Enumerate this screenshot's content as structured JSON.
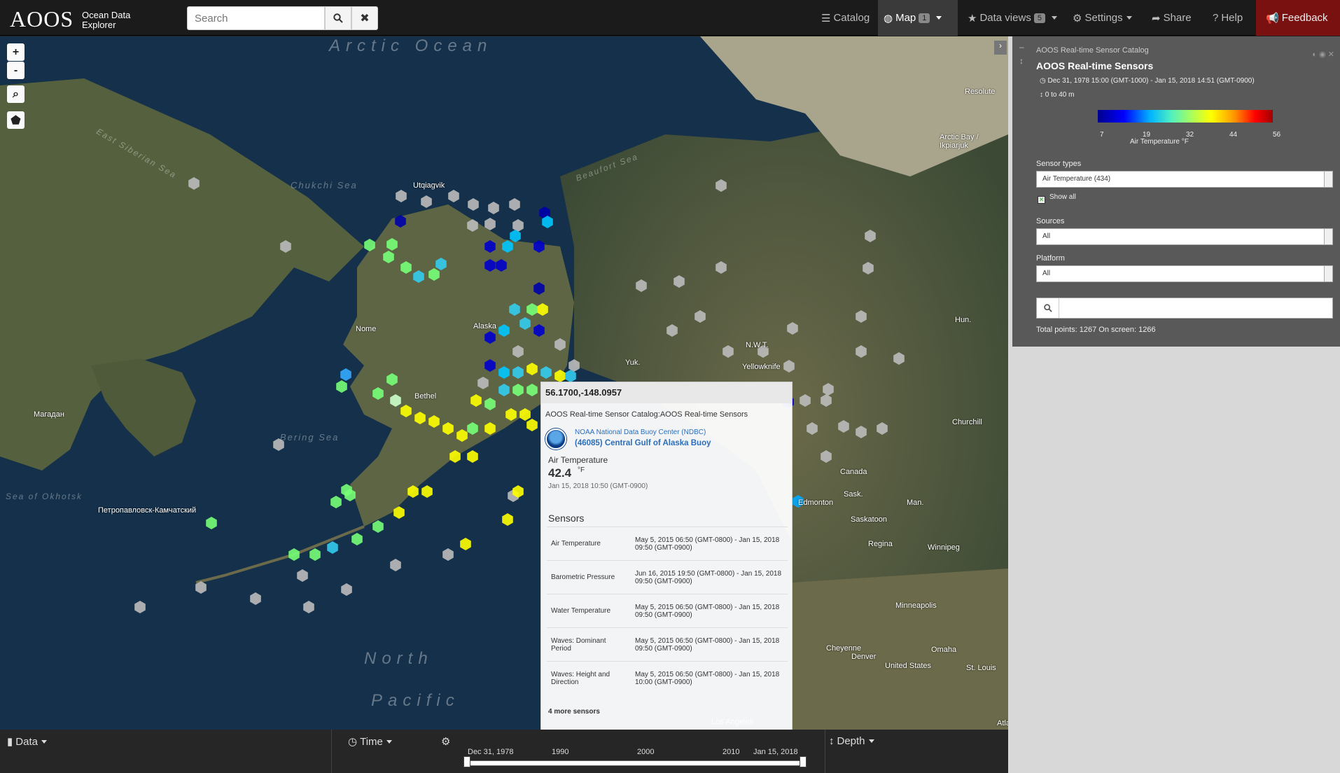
{
  "topbar": {
    "logo": "AOOS",
    "logo_sub_1": "Ocean Data",
    "logo_sub_2": "Explorer",
    "search_placeholder": "Search",
    "nav": {
      "catalog": "Catalog",
      "map": "Map",
      "map_count": "1",
      "data_views": "Data views",
      "data_views_count": "5",
      "settings": "Settings",
      "share": "Share",
      "help": "Help",
      "feedback": "Feedback"
    }
  },
  "map": {
    "labels": [
      "Utqiagvik",
      "Alaska",
      "Nome",
      "Bethel",
      "Yellowknife",
      "Resolute",
      "Arctic Bay / Ikpiarjuk",
      "Churchill",
      "Canada",
      "Edmonton",
      "Saskatoon",
      "Regina",
      "Winnipeg",
      "Minneapolis",
      "United States",
      "Omaha",
      "Denver",
      "Cheyenne",
      "St. Louis",
      "Нun.",
      "N.W.T.",
      "Yuk.",
      "Sask.",
      "Man.",
      "Магадан",
      "Петропавловск-Камчатский",
      "Los Angeles",
      "Atla"
    ],
    "seas": {
      "arctic": "Arctic Ocean",
      "chukchi": "Chukchi Sea",
      "bering": "Bering Sea",
      "beaufort": "Beaufort Sea",
      "east_siberian": "East Siberian Sea",
      "okhotsk": "Sea of Okhotsk",
      "pacific_1": "North",
      "pacific_2": "Pacific"
    }
  },
  "popup": {
    "coords": "56.1700,-148.0957",
    "layer": "AOOS Real-time Sensor Catalog:AOOS Real-time Sensors",
    "source": "NOAA National Data Buoy Center (NDBC)",
    "station": "(46085) Central Gulf of Alaska Buoy",
    "measure": "Air Temperature",
    "value": "42.4",
    "unit": "°F",
    "time": "Jan 15, 2018 10:50 (GMT-0900)",
    "sensors_heading": "Sensors",
    "sensors": [
      {
        "name": "Air Temperature",
        "range": "May 5, 2015 06:50 (GMT-0800) - Jan 15, 2018 09:50 (GMT-0900)"
      },
      {
        "name": "Barometric Pressure",
        "range": "Jun 16, 2015 19:50 (GMT-0800) - Jan 15, 2018 09:50 (GMT-0900)"
      },
      {
        "name": "Water Temperature",
        "range": "May 5, 2015 06:50 (GMT-0800) - Jan 15, 2018 09:50 (GMT-0900)"
      },
      {
        "name": "Waves: Dominant Period",
        "range": "May 5, 2015 06:50 (GMT-0800) - Jan 15, 2018 09:50 (GMT-0900)"
      },
      {
        "name": "Waves: Height and Direction",
        "range": "May 5, 2015 06:50 (GMT-0800) - Jan 15, 2018 10:00 (GMT-0900)"
      }
    ],
    "more": "4 more sensors"
  },
  "panel": {
    "catalog": "AOOS Real-time Sensor Catalog",
    "title": "AOOS Real-time Sensors",
    "date_range": "Dec 31, 1978 15:00 (GMT-1000) - Jan 15, 2018 14:51 (GMT-0900)",
    "depth": "0 to 40 m",
    "legend_ticks": [
      "7",
      "19",
      "32",
      "44",
      "56"
    ],
    "legend_label": "Air Temperature °F",
    "sensor_types_label": "Sensor types",
    "sensor_types_value": "Air Temperature (434)",
    "show_all": "Show all",
    "sources_label": "Sources",
    "sources_value": "All",
    "platform_label": "Platform",
    "platform_value": "All",
    "totals": "Total points: 1267 On screen: 1266"
  },
  "bottombar": {
    "data": "Data",
    "time": "Time",
    "depth": "Depth",
    "timeline_start": "Dec 31, 1978",
    "timeline_end": "Jan 15, 2018",
    "timeline_ticks": [
      "1990",
      "2000",
      "2010"
    ]
  }
}
